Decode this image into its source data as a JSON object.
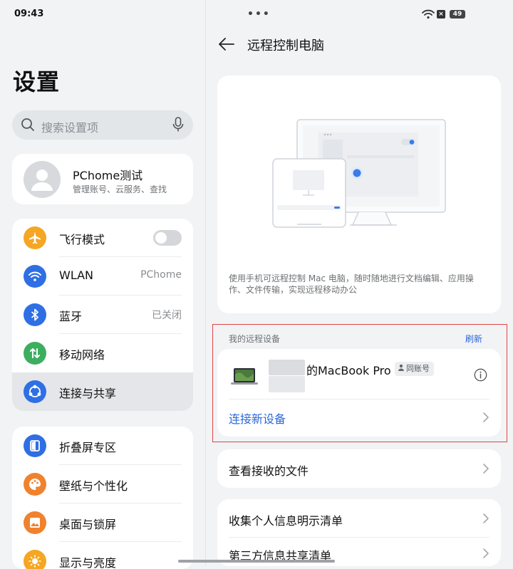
{
  "status": {
    "time": "09:43",
    "dots": "•••",
    "battery": "49"
  },
  "left": {
    "title": "设置",
    "search_placeholder": "搜索设置项",
    "account": {
      "name": "PChome测试",
      "subtitle": "管理账号、云服务、查找"
    },
    "group1": [
      {
        "label": "飞行模式",
        "icon": "airplane-icon",
        "color": "#f5a623",
        "toggle": "off"
      },
      {
        "label": "WLAN",
        "value": "PChome",
        "icon": "wifi-icon",
        "color": "#2f6fe4"
      },
      {
        "label": "蓝牙",
        "value": "已关闭",
        "icon": "bluetooth-icon",
        "color": "#2f6fe4"
      },
      {
        "label": "移动网络",
        "icon": "mobile-network-icon",
        "color": "#3dae5f"
      },
      {
        "label": "连接与共享",
        "icon": "share-icon",
        "color": "#2f6fe4",
        "selected": true
      }
    ],
    "group2": [
      {
        "label": "折叠屏专区",
        "icon": "fold-icon",
        "color": "#2f6fe4"
      },
      {
        "label": "壁纸与个性化",
        "icon": "palette-icon",
        "color": "#f0822e"
      },
      {
        "label": "桌面与锁屏",
        "icon": "picture-icon",
        "color": "#f0822e"
      },
      {
        "label": "显示与亮度",
        "icon": "brightness-icon",
        "color": "#f5a623"
      }
    ]
  },
  "right": {
    "title": "远程控制电脑",
    "description": "使用手机可远程控制 Mac 电脑，随时随地进行文档编辑、应用操作、文件传输，实现远程移动办公",
    "section_label": "我的远程设备",
    "refresh": "刷新",
    "device": {
      "name": "的MacBook Pro",
      "badge": "同账号"
    },
    "connect_new": "连接新设备",
    "received_files": "查看接收的文件",
    "personal_info": "收集个人信息明示清单",
    "third_party": "第三方信息共享清单"
  }
}
